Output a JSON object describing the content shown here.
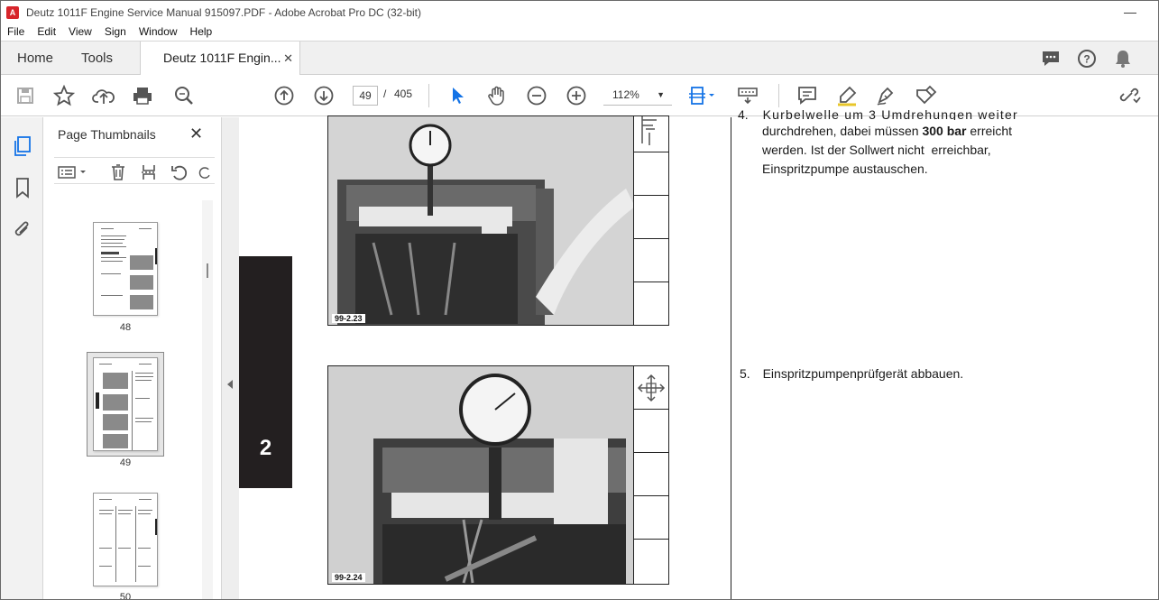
{
  "window": {
    "title": "Deutz 1011F Engine Service Manual 915097.PDF - Adobe Acrobat Pro DC (32-bit)"
  },
  "menu": {
    "items": [
      "File",
      "Edit",
      "View",
      "Sign",
      "Window",
      "Help"
    ]
  },
  "tabs": {
    "home": "Home",
    "tools": "Tools",
    "document": "Deutz 1011F Engin...",
    "close": "✕"
  },
  "toolbar": {
    "page_current": "49",
    "page_sep": "/",
    "page_total": "405",
    "zoom": "112%"
  },
  "thumbnails": {
    "title": "Page Thumbnails",
    "pages": [
      {
        "label": "48"
      },
      {
        "label": "49",
        "selected": true
      },
      {
        "label": "50"
      }
    ]
  },
  "document": {
    "section_number": "2",
    "figures": [
      {
        "label": "99-2.23"
      },
      {
        "label": "99-2.24"
      }
    ],
    "step4_cut": "Kurbelwelle um 3 Umdrehungen weiter",
    "step4_line2_pre": "durchdrehen, dabei müssen ",
    "step4_line2_bold": "300 bar",
    "step4_line2_post": " erreicht",
    "step4_line3": "werden. Ist der Sollwert nicht  erreichbar,",
    "step4_line4": "Einspritzpumpe austauschen.",
    "step5_num": "5.",
    "step5_text": "Einspritzpumpenprüfgerät abbauen.",
    "step4_num": "4."
  },
  "colors": {
    "accent": "#1473e6",
    "section_tab": "#231f20"
  }
}
